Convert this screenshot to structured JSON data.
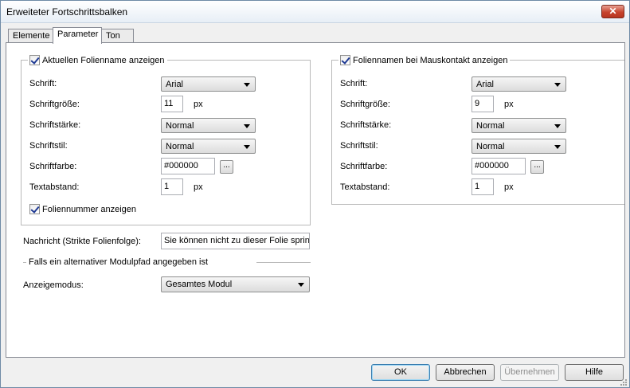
{
  "window": {
    "title": "Erweiteter Fortschrittsbalken",
    "close_label": "✕"
  },
  "tabs": [
    "Elemente",
    "Parameter",
    "Ton"
  ],
  "left_group": {
    "legend": "Aktuellen Folienname anzeigen",
    "checked": true,
    "font_label": "Schrift:",
    "font_value": "Arial",
    "size_label": "Schriftgröße:",
    "size_value": "11",
    "size_unit": "px",
    "weight_label": "Schriftstärke:",
    "weight_value": "Normal",
    "style_label": "Schriftstil:",
    "style_value": "Normal",
    "color_label": "Schriftfarbe:",
    "color_value": "#000000",
    "spacing_label": "Textabstand:",
    "spacing_value": "1",
    "spacing_unit": "px",
    "slide_number_label": "Foliennummer anzeigen",
    "slide_number_checked": true
  },
  "right_group": {
    "legend": "Foliennamen bei Mauskontakt anzeigen",
    "checked": true,
    "font_label": "Schrift:",
    "font_value": "Arial",
    "size_label": "Schriftgröße:",
    "size_value": "9",
    "size_unit": "px",
    "weight_label": "Schriftstärke:",
    "weight_value": "Normal",
    "style_label": "Schriftstil:",
    "style_value": "Normal",
    "color_label": "Schriftfarbe:",
    "color_value": "#000000",
    "spacing_label": "Textabstand:",
    "spacing_value": "1",
    "spacing_unit": "px"
  },
  "message": {
    "label": "Nachricht (Strikte Folienfolge):",
    "value": "Sie können nicht zu dieser Folie springen"
  },
  "module_section": {
    "heading": "Falls ein alternativer Modulpfad angegeben ist"
  },
  "display_mode": {
    "label": "Anzeigemodus:",
    "value": "Gesamtes Modul"
  },
  "buttons": {
    "ok": "OK",
    "cancel": "Abbrechen",
    "apply": "Übernehmen",
    "help": "Hilfe"
  },
  "icons": {
    "browse": "...",
    "dropdown": "chevron-down-icon"
  }
}
